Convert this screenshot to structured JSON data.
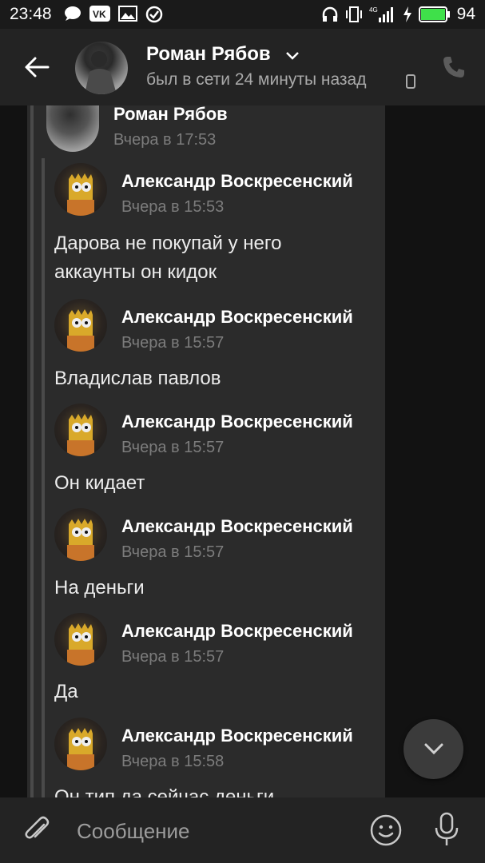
{
  "status_bar": {
    "time": "23:48",
    "battery": "94",
    "network": "4G",
    "icons_left": [
      "chat-bubble-icon",
      "vk-logo-icon",
      "image-icon",
      "check-circle-icon"
    ],
    "icons_right": [
      "headphones-icon",
      "vibrate-icon",
      "signal-icon",
      "charging-icon",
      "battery-icon"
    ]
  },
  "header": {
    "name": "Роман Рябов",
    "status": "был в сети 24 минуты назад"
  },
  "forwarded": {
    "author": "Роман Рябов",
    "time": "Вчера в 17:53"
  },
  "messages": [
    {
      "author": "Александр Воскресенский",
      "time": "Вчера в 15:53",
      "text_lines": [
        "Дарова не покупай у него",
        "аккаунты он кидок"
      ]
    },
    {
      "author": "Александр Воскресенский",
      "time": "Вчера в 15:57",
      "text": "Владислав павлов"
    },
    {
      "author": "Александр Воскресенский",
      "time": "Вчера в 15:57",
      "text": "Он кидает"
    },
    {
      "author": "Александр Воскресенский",
      "time": "Вчера в 15:57",
      "text": "На деньги"
    },
    {
      "author": "Александр Воскресенский",
      "time": "Вчера в 15:57",
      "text": "Да"
    },
    {
      "author": "Александр Воскресенский",
      "time": "Вчера в 15:58",
      "text": "Он тип да сейчас деньги"
    }
  ],
  "composer": {
    "placeholder": "Сообщение"
  },
  "colors": {
    "background": "#121212",
    "card": "#2b2b2b",
    "header": "#232323",
    "battery": "#3fe04a",
    "muted_text": "#7c7c7c"
  }
}
